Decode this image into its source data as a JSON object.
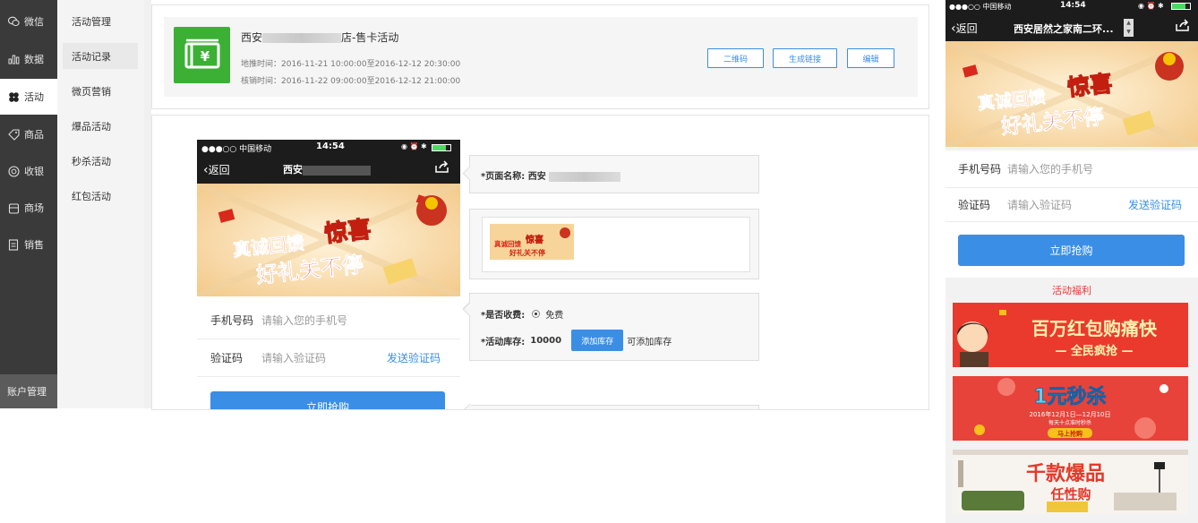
{
  "colors": {
    "accent": "#3a8ee6",
    "nav_bg": "#3a3a3a",
    "green_icon": "#3cb034",
    "required": "#e33333"
  },
  "nav": {
    "items": [
      {
        "label": "微信",
        "icon": "wechat-icon"
      },
      {
        "label": "数据",
        "icon": "bar-chart-icon"
      },
      {
        "label": "活动",
        "icon": "clover-icon",
        "active": true
      },
      {
        "label": "商品",
        "icon": "tag-icon"
      },
      {
        "label": "收银",
        "icon": "cashier-icon"
      },
      {
        "label": "商场",
        "icon": "mall-icon"
      },
      {
        "label": "销售",
        "icon": "document-icon"
      }
    ],
    "account": "账户管理"
  },
  "subnav": {
    "items": [
      {
        "label": "活动管理"
      },
      {
        "label": "活动记录",
        "active": true
      },
      {
        "label": "微页营销"
      },
      {
        "label": "爆品活动"
      },
      {
        "label": "秒杀活动"
      },
      {
        "label": "红包活动"
      }
    ]
  },
  "activity": {
    "title_prefix": "西安",
    "title_suffix": "店-售卡活动",
    "promo_time": "地推时间：2016-11-21 10:00:00至2016-12-12 20:30:00",
    "verify_time": "核销时间：2016-11-22 09:00:00至2016-12-12 21:00:00",
    "buttons": {
      "qrcode": "二维码",
      "gen_link": "生成链接",
      "edit": "编辑"
    }
  },
  "phone": {
    "carrier": "●●●○○ 中国移动",
    "time": "14:54",
    "back": "返回",
    "title_prefix": "西安",
    "banner_line1": "真诚回馈",
    "banner_line2": "惊喜",
    "banner_line3": "好礼关不停",
    "phone_label": "手机号码",
    "phone_placeholder": "请输入您的手机号",
    "code_label": "验证码",
    "code_placeholder": "请输入验证码",
    "send_code": "发送验证码",
    "buy": "立即抢购"
  },
  "form": {
    "page_name_label": "*页面名称:",
    "page_name_value": "西安",
    "fee_label": "*是否收费:",
    "fee_option": "免费",
    "stock_label": "*活动库存:",
    "stock_value": "10000",
    "add_stock_button": "添加库存",
    "add_stock_hint": "可添加库存"
  },
  "right_phone": {
    "carrier": "●●●○○ 中国移动",
    "time": "14:54",
    "back": "返回",
    "title": "西安居然之家南二环...",
    "phone_label": "手机号码",
    "phone_placeholder": "请输入您的手机号",
    "code_label": "验证码",
    "code_placeholder": "请输入验证码",
    "send_code": "发送验证码",
    "buy": "立即抢购",
    "benefits_title": "活动福利",
    "promo1_title": "百万红包购痛快",
    "promo1_sub": "— 全民疯抢 —",
    "promo2_title": "1元秒杀",
    "promo2_sub": "2016年12月1日—12月10日",
    "promo2_sub2": "每天十点准时秒杀",
    "promo2_btn": "马上抢购",
    "promo3_title": "千款爆品",
    "promo3_sub": "任性购"
  }
}
